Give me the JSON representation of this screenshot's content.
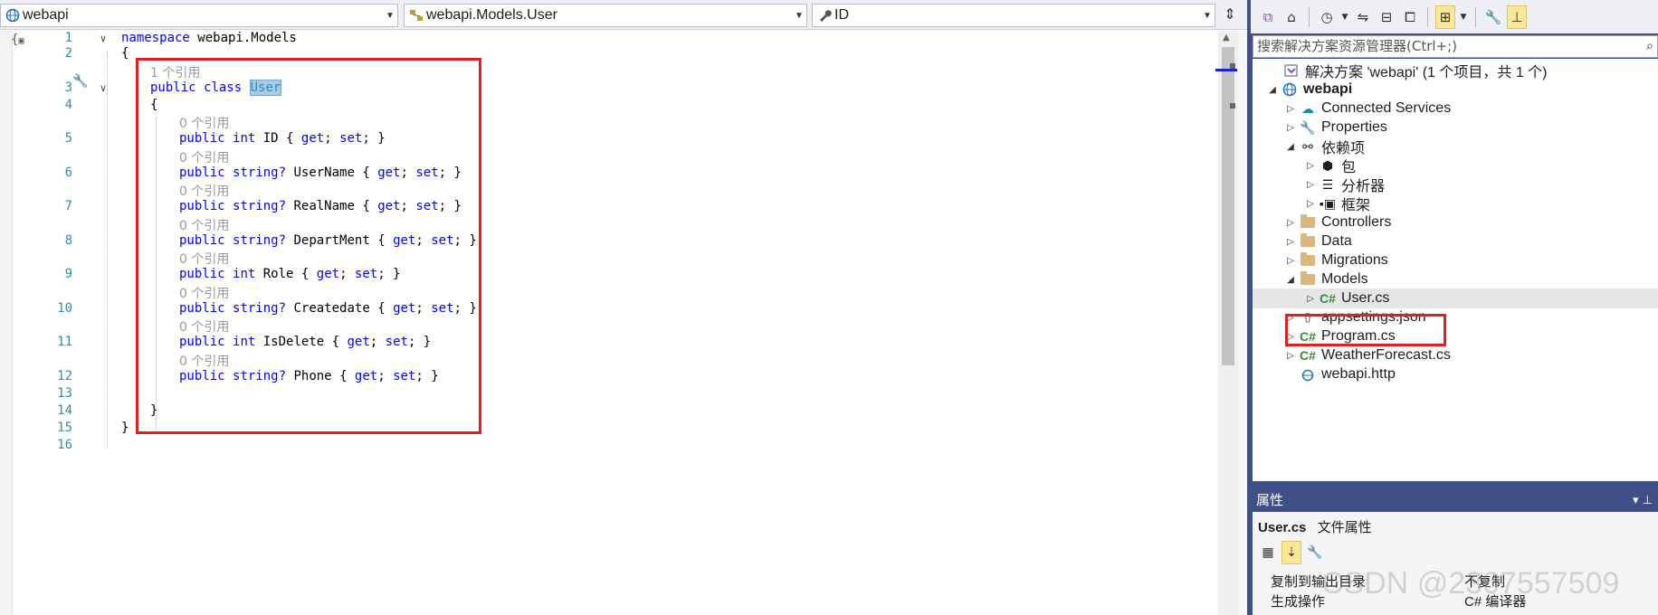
{
  "nav": {
    "project": "webapi",
    "type": "webapi.Models.User",
    "member": "ID"
  },
  "code": {
    "lines": [
      {
        "no": "1"
      },
      {
        "no": "2"
      },
      {
        "no": "3"
      },
      {
        "no": "4"
      },
      {
        "no": "5"
      },
      {
        "no": "6"
      },
      {
        "no": "7"
      },
      {
        "no": "8"
      },
      {
        "no": "9"
      },
      {
        "no": "10"
      },
      {
        "no": "11"
      },
      {
        "no": "12"
      },
      {
        "no": "13"
      },
      {
        "no": "14"
      },
      {
        "no": "15"
      },
      {
        "no": "16"
      }
    ],
    "namespace_kw": "namespace",
    "namespace_name": "webapi.Models",
    "open_brace": "{",
    "close_brace": "}",
    "class_refs": "1 个引用",
    "public_kw": "public",
    "class_kw": "class",
    "class_name": "User",
    "member_refs": "0 个引用",
    "members": [
      {
        "type": "int",
        "name": "ID"
      },
      {
        "type": "string?",
        "name": "UserName"
      },
      {
        "type": "string?",
        "name": "RealName"
      },
      {
        "type": "string?",
        "name": "DepartMent"
      },
      {
        "type": "int",
        "name": "Role"
      },
      {
        "type": "string?",
        "name": "Createdate"
      },
      {
        "type": "int",
        "name": "IsDelete"
      },
      {
        "type": "string?",
        "name": "Phone"
      }
    ],
    "accessor_open": "{ ",
    "get_kw": "get",
    "set_kw": "set",
    "accessor_close": "; }"
  },
  "solution_explorer": {
    "search_placeholder": "搜索解决方案资源管理器(Ctrl+;)",
    "items": [
      {
        "label": "解决方案 'webapi' (1 个项目，共 1 个)",
        "icon": "solution-icon"
      },
      {
        "label": "webapi",
        "icon": "web-project-icon"
      },
      {
        "label": "Connected Services",
        "icon": "connected-services-icon"
      },
      {
        "label": "Properties",
        "icon": "wrench-icon"
      },
      {
        "label": "依赖项",
        "icon": "dependencies-icon"
      },
      {
        "label": "包",
        "icon": "package-icon"
      },
      {
        "label": "分析器",
        "icon": "analyzer-icon"
      },
      {
        "label": "框架",
        "icon": "framework-icon"
      },
      {
        "label": "Controllers",
        "icon": "folder-icon"
      },
      {
        "label": "Data",
        "icon": "folder-icon"
      },
      {
        "label": "Migrations",
        "icon": "folder-icon"
      },
      {
        "label": "Models",
        "icon": "folder-icon"
      },
      {
        "label": "User.cs",
        "icon": "csharp-file-icon"
      },
      {
        "label": "appsettings.json",
        "icon": "json-file-icon"
      },
      {
        "label": "Program.cs",
        "icon": "csharp-file-icon"
      },
      {
        "label": "WeatherForecast.cs",
        "icon": "csharp-file-icon"
      },
      {
        "label": "webapi.http",
        "icon": "http-file-icon"
      }
    ]
  },
  "properties": {
    "header": "属性",
    "file_name": "User.cs",
    "file_kind": "文件属性",
    "rows": [
      {
        "key": "复制到输出目录",
        "value": "不复制"
      },
      {
        "key": "生成操作",
        "value": "C# 编译器"
      }
    ]
  },
  "watermark": "CSDN @2307557509",
  "colors": {
    "keyword": "#0000ff",
    "type_name": "#2b91af",
    "highlight_box": "#e61e1e",
    "tool_window": "#404f88"
  }
}
